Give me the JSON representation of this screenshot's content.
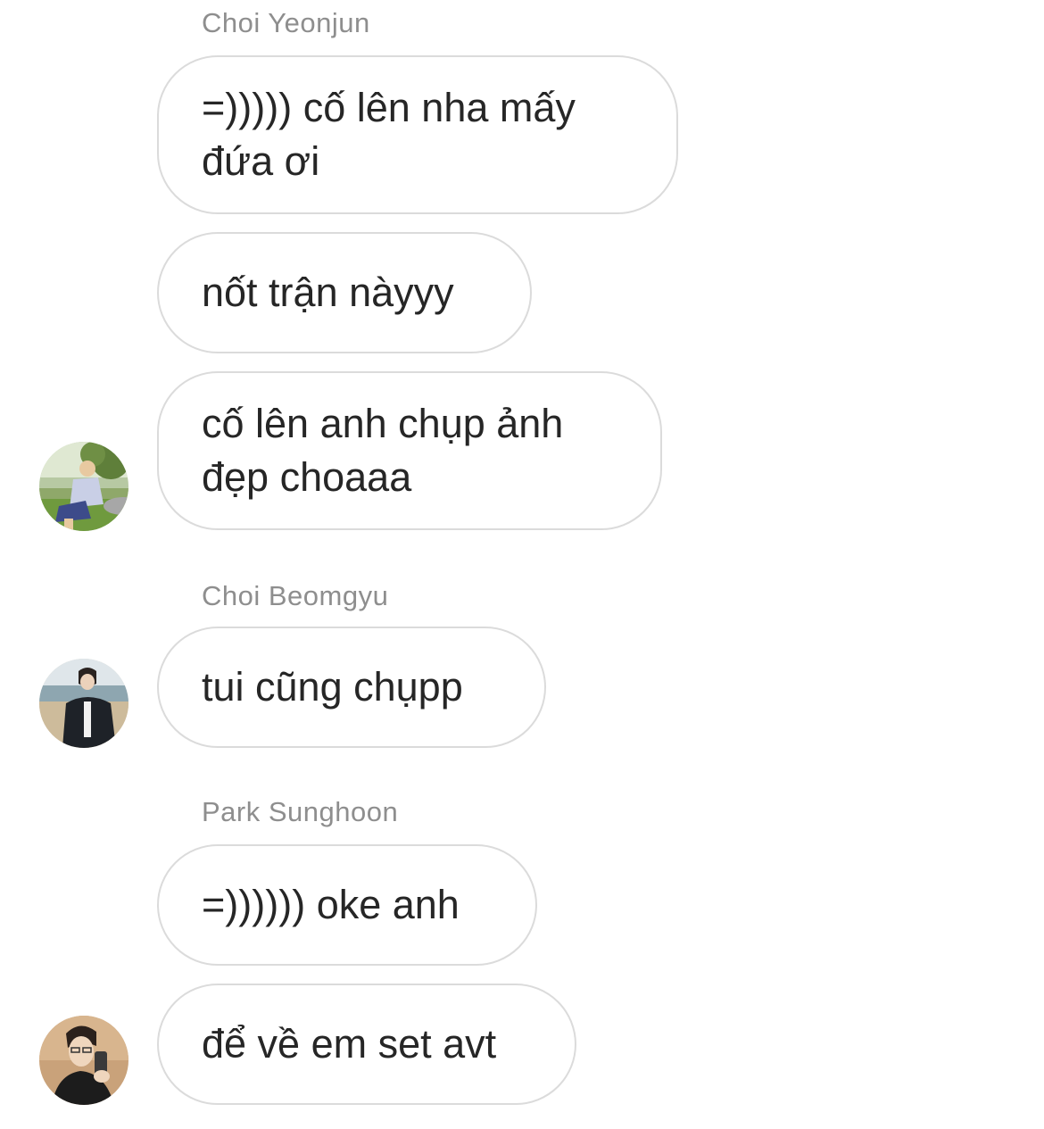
{
  "thread": {
    "groups": [
      {
        "sender": "Choi Yeonjun",
        "messages": [
          "=))))) cố lên nha mấy đứa ơi",
          "nốt trận nàyyy",
          "cố lên anh chụp ảnh đẹp choaaa"
        ],
        "avatar_icon": "profile-photo-outdoor-icon"
      },
      {
        "sender": "Choi Beomgyu",
        "messages": [
          "tui cũng chụpp"
        ],
        "avatar_icon": "profile-photo-beach-icon"
      },
      {
        "sender": "Park Sunghoon",
        "messages": [
          "=)))))) oke anh",
          "để về em set avt"
        ],
        "avatar_icon": "profile-photo-mirror-selfie-icon"
      }
    ]
  },
  "colors": {
    "bubble_border": "#dbdbdb",
    "sender_name": "#8e8e8e",
    "message_text": "#262626",
    "background": "#ffffff"
  }
}
